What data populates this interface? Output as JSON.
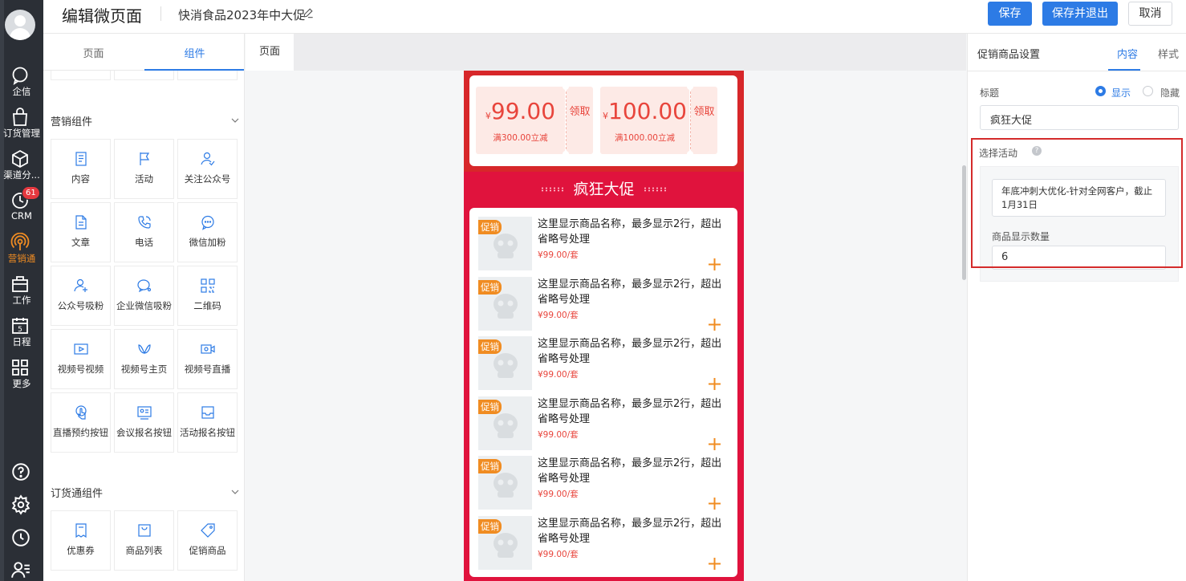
{
  "header": {
    "title": "编辑微页面",
    "subtitle": "快消食品2023年中大促",
    "save_label": "保存",
    "save_exit_label": "保存并退出",
    "cancel_label": "取消"
  },
  "nav": {
    "items": [
      {
        "label": "企信",
        "icon": "chat-bubble-icon"
      },
      {
        "label": "订货管理",
        "icon": "shopping-bag-icon"
      },
      {
        "label": "渠道分...",
        "icon": "cube-icon"
      },
      {
        "label": "CRM",
        "icon": "clock-icon",
        "badge": "61"
      },
      {
        "label": "营销通",
        "icon": "broadcast-icon",
        "active": true
      },
      {
        "label": "工作",
        "icon": "briefcase-icon"
      },
      {
        "label": "日程",
        "icon": "calendar-icon",
        "day": "5"
      },
      {
        "label": "更多",
        "icon": "grid-icon"
      }
    ],
    "bottom_icons": [
      "help-icon",
      "settings-icon",
      "history-icon",
      "contacts-icon"
    ]
  },
  "sidebar": {
    "tabs": [
      "页面",
      "组件"
    ],
    "active_tab": "组件",
    "sections": [
      {
        "title": "营销组件",
        "items": [
          {
            "label": "内容",
            "icon": "document-icon"
          },
          {
            "label": "活动",
            "icon": "flag-icon"
          },
          {
            "label": "关注公众号",
            "icon": "user-follow-icon"
          },
          {
            "label": "文章",
            "icon": "article-icon"
          },
          {
            "label": "电话",
            "icon": "phone-icon"
          },
          {
            "label": "微信加粉",
            "icon": "wechat-bubble-icon"
          },
          {
            "label": "公众号吸粉",
            "icon": "user-add-icon"
          },
          {
            "label": "企业微信吸粉",
            "icon": "enterprise-wechat-icon"
          },
          {
            "label": "二维码",
            "icon": "qrcode-icon"
          },
          {
            "label": "视频号视频",
            "icon": "video-icon"
          },
          {
            "label": "视频号主页",
            "icon": "channels-icon"
          },
          {
            "label": "视频号直播",
            "icon": "live-camera-icon"
          },
          {
            "label": "直播预约按钮",
            "icon": "touch-icon"
          },
          {
            "label": "会议报名按钮",
            "icon": "id-card-icon"
          },
          {
            "label": "活动报名按钮",
            "icon": "inbox-icon"
          }
        ]
      },
      {
        "title": "订货通组件",
        "items": [
          {
            "label": "优惠券",
            "icon": "coupon-icon"
          },
          {
            "label": "商品列表",
            "icon": "shop-bag-icon"
          },
          {
            "label": "促销商品",
            "icon": "tag-icon"
          }
        ]
      }
    ]
  },
  "canvas": {
    "tab_label": "页面",
    "coupons": [
      {
        "currency": "¥",
        "amount": "99.00",
        "condition": "满300.00立减",
        "action": "领取"
      },
      {
        "currency": "¥",
        "amount": "100.00",
        "condition": "满1000.00立减",
        "action": "领取"
      }
    ],
    "banner_title": "疯狂大促",
    "products": [
      {
        "badge": "促销",
        "name": "这里显示商品名称，最多显示2行，超出省略号处理",
        "price": "¥99.00/套"
      },
      {
        "badge": "促销",
        "name": "这里显示商品名称，最多显示2行，超出省略号处理",
        "price": "¥99.00/套"
      },
      {
        "badge": "促销",
        "name": "这里显示商品名称，最多显示2行，超出省略号处理",
        "price": "¥99.00/套"
      },
      {
        "badge": "促销",
        "name": "这里显示商品名称，最多显示2行，超出省略号处理",
        "price": "¥99.00/套"
      },
      {
        "badge": "促销",
        "name": "这里显示商品名称，最多显示2行，超出省略号处理",
        "price": "¥99.00/套"
      },
      {
        "badge": "促销",
        "name": "这里显示商品名称，最多显示2行，超出省略号处理",
        "price": "¥99.00/套"
      }
    ]
  },
  "properties": {
    "panel_title": "促销商品设置",
    "tabs": [
      "内容",
      "样式"
    ],
    "active_tab": "内容",
    "title_label": "标题",
    "show_label": "显示",
    "hide_label": "隐藏",
    "title_visible": true,
    "title_value": "疯狂大促",
    "activity_label": "选择活动",
    "activity_help": "?",
    "activity_value": "年底冲刺大优化-针对全网客户，截止1月31日",
    "count_label": "商品显示数量",
    "count_value": "6"
  },
  "colors": {
    "accent": "#2d7be5",
    "promo_red": "#e0133d",
    "promo_orange": "#f08c22",
    "price_red": "#e8453c",
    "nav_bg": "#2b2f36"
  }
}
